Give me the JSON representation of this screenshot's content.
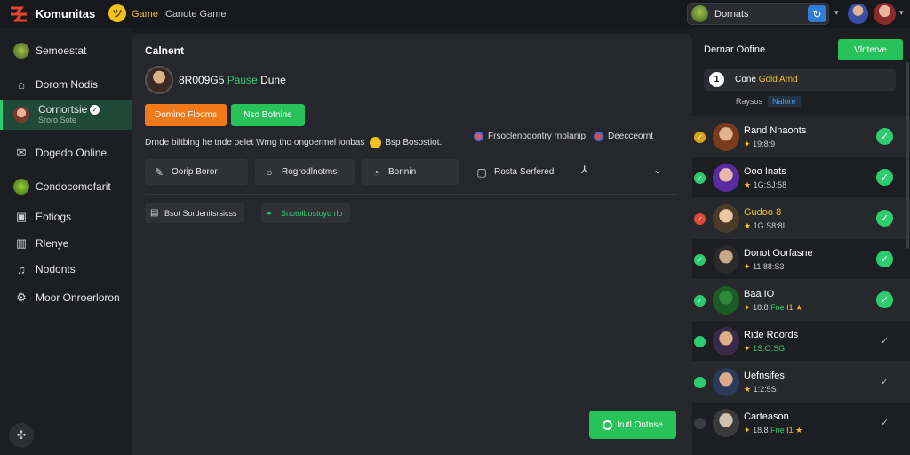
{
  "topbar": {
    "brand": "Komunitas",
    "coin_glyph": "ツ",
    "link_game": "Game",
    "link_canote": "Canote Game",
    "search_user": "Dornats",
    "search_button_glyph": "↻",
    "caret": "▾"
  },
  "sidebar": {
    "items": [
      {
        "label": "Semoestat",
        "icon": "user-avatar-icon"
      },
      {
        "label": "Dorom Nodis",
        "icon": "home-icon"
      },
      {
        "label": "Cornortsie",
        "sub": "Sroro Sote",
        "icon": "profile-icon"
      },
      {
        "label": "Dogedo Online",
        "icon": "mail-icon"
      },
      {
        "label": "Condocomofarit",
        "icon": "globe-icon"
      },
      {
        "label": "Eotiogs",
        "icon": "tag-icon"
      },
      {
        "label": "Rlenye",
        "icon": "chart-icon"
      },
      {
        "label": "Nodonts",
        "icon": "bell-icon"
      },
      {
        "label": "Moor Onroerloron",
        "icon": "settings-icon"
      }
    ],
    "bottom_glyph": "✣"
  },
  "main": {
    "title": "Calnent",
    "user_id": "8R009G5",
    "user_tag": "Pause",
    "user_tag2": "Dune",
    "btn_orange": "Domino Flooms",
    "btn_green": "Nso Botnine",
    "description": "Drnde biltbing he tnde oelet Wmg tho ongoermel ionbas",
    "desc_after": "Bsp Bosostiot.",
    "tag1": "Frsoclenoqontry rnolanip",
    "tag2": "Deecceornt",
    "pills": [
      {
        "label": "Oorip Boror",
        "icon": "edit-icon",
        "glyph": "✎"
      },
      {
        "label": "Rogrodlnotms",
        "icon": "circle-icon",
        "glyph": "○"
      },
      {
        "label": "Bonnin",
        "icon": "compass-icon",
        "glyph": "◔"
      },
      {
        "label": "Rosta Serfered",
        "icon": "square-icon",
        "glyph": "▢"
      }
    ],
    "arrow_glyph": "⅄",
    "chevron_glyph": "⌄",
    "chips": [
      {
        "label": "Bsot Sordenitsrsicss",
        "glyph": "▤"
      },
      {
        "label": "Snotolbostoyo rlo",
        "glyph": "◒"
      }
    ],
    "bottom_button": "Irutl Ontnse"
  },
  "right": {
    "title": "Dernar Oofine",
    "button": "Vlnterve",
    "status_num": "1",
    "status_text": "Cone",
    "status_highlight": "Gold Amd",
    "sub_label": "Raysos",
    "sub_badge": "Nalore",
    "friends": [
      {
        "name": "Rand Nnaonts",
        "meta": "19:8:9",
        "meta_icon": "✦",
        "status_color": "#d4a517",
        "av1": "#7a3a1e",
        "av2": "#e2b38e",
        "check": true
      },
      {
        "name": "Ooo Inats",
        "meta": "1G:SJ:58",
        "meta_icon": "★",
        "status_color": "#2ecc71",
        "av1": "#5a2aa0",
        "av2": "#e8b8a8",
        "check": true
      },
      {
        "name": "Gudoo 8",
        "meta": "1G.S8:8I",
        "meta_icon": "★",
        "status_color": "#e04a3a",
        "av1": "#4a3a2a",
        "av2": "#e8c9a0",
        "check": true,
        "name_color": "#f2c21b"
      },
      {
        "name": "Donot Oorfasne",
        "meta": "11:88:S3",
        "meta_icon": "✦",
        "status_color": "#2ecc71",
        "av1": "#2a2a2a",
        "av2": "#c9a98a",
        "check": true
      },
      {
        "name": "Baa IO",
        "meta": "18.8",
        "meta_extra": "Fne",
        "meta_extra2": "I1",
        "meta_icon": "✦",
        "status_color": "#2ecc71",
        "av1": "#1c5a2a",
        "av2": "#2c8a3a",
        "check": true
      },
      {
        "name": "Ride Roords",
        "meta": "1S:O:SG",
        "meta_icon": "✦",
        "status_color": "#2ecc71",
        "av1": "#3a2a4a",
        "av2": "#e0b08a",
        "check": false,
        "meta_green": true
      },
      {
        "name": "Uefnsifes",
        "meta": "1:2:5S",
        "meta_icon": "★",
        "status_color": "#2ecc71",
        "av1": "#2a3a5a",
        "av2": "#d9a98a",
        "check": false
      },
      {
        "name": "Carteason",
        "meta": "18.8",
        "meta_extra": "Fne",
        "meta_extra2": "I1",
        "meta_icon": "✦",
        "status_color": "#3a3c42",
        "av1": "#3a3a3a",
        "av2": "#d0c0b0",
        "check": false
      }
    ],
    "check_glyph": "✓"
  }
}
